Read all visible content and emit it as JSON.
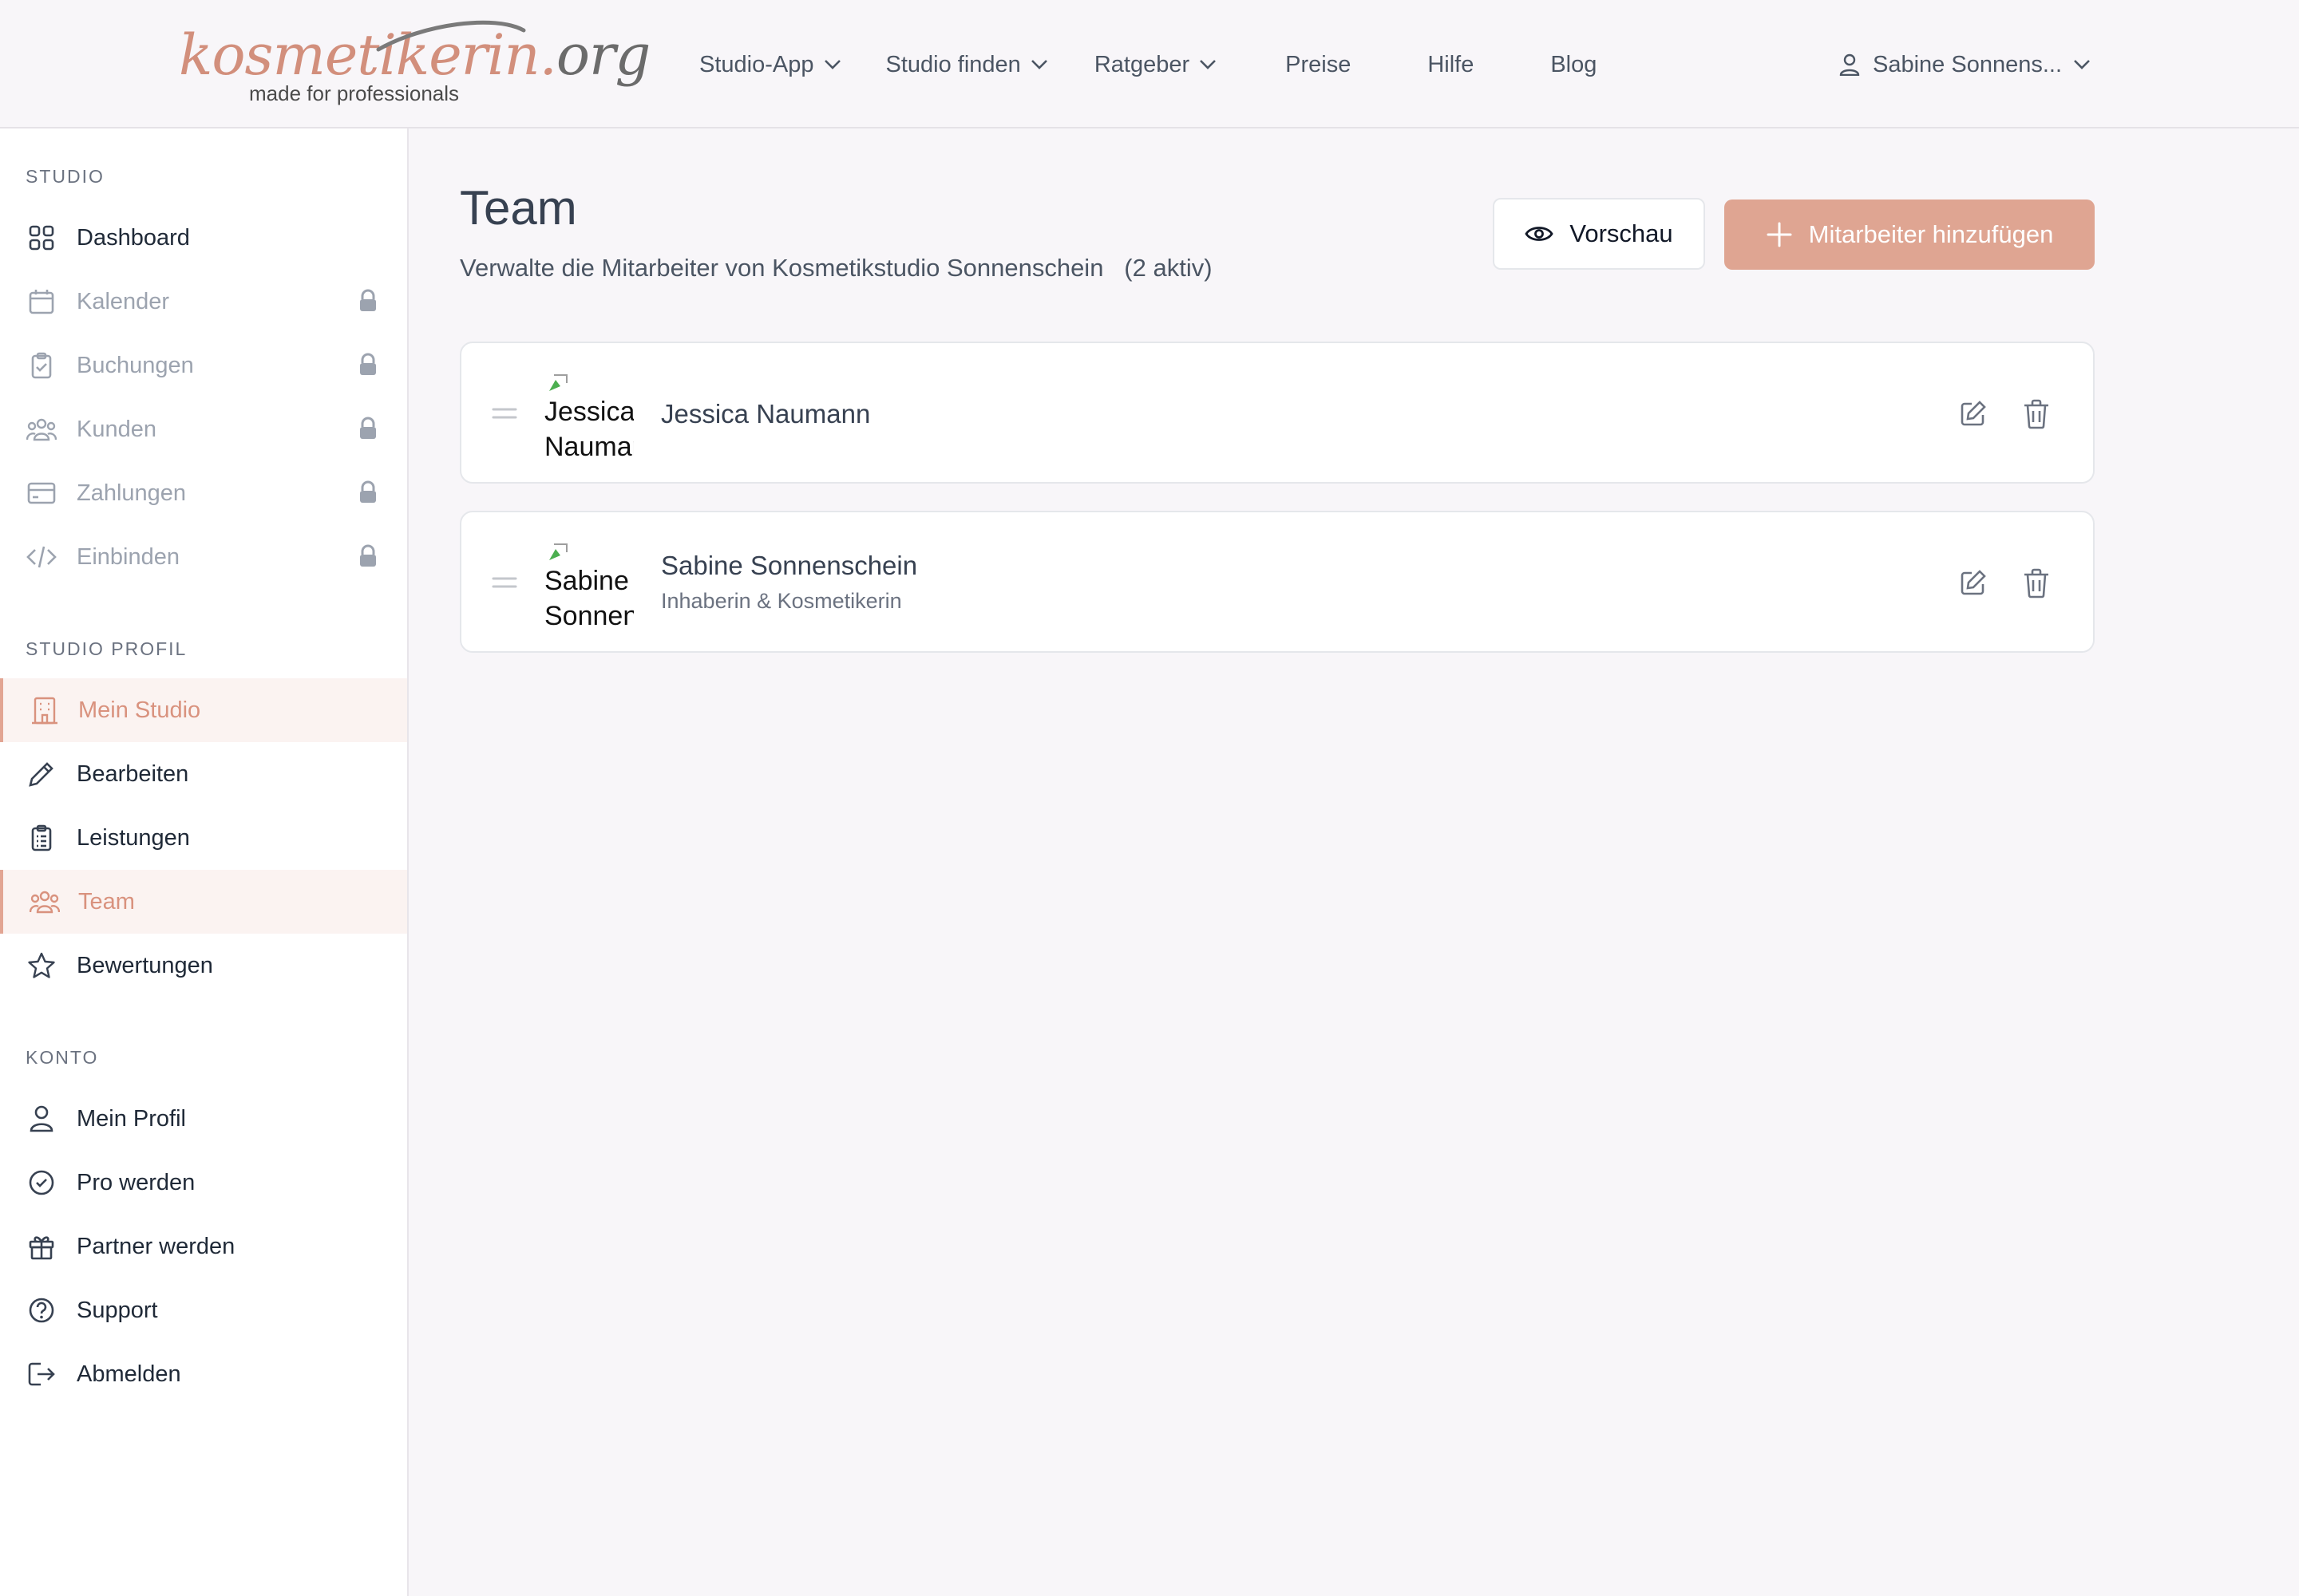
{
  "brand": {
    "name_main": "kosmetikerin.",
    "name_tld": "org",
    "tagline": "made for professionals",
    "accent_color": "#dfa592"
  },
  "topnav": {
    "items": [
      {
        "label": "Studio-App",
        "dropdown": true
      },
      {
        "label": "Studio finden",
        "dropdown": true
      },
      {
        "label": "Ratgeber",
        "dropdown": true
      },
      {
        "label": "Preise",
        "dropdown": false
      },
      {
        "label": "Hilfe",
        "dropdown": false
      },
      {
        "label": "Blog",
        "dropdown": false
      }
    ],
    "user_label": "Sabine Sonnens..."
  },
  "sidebar": {
    "sections": {
      "studio": "STUDIO",
      "studio_profil": "STUDIO PROFIL",
      "konto": "KONTO"
    },
    "studio_items": [
      {
        "label": "Dashboard",
        "icon": "grid-icon",
        "locked": false
      },
      {
        "label": "Kalender",
        "icon": "calendar-icon",
        "locked": true
      },
      {
        "label": "Buchungen",
        "icon": "clipboard-check-icon",
        "locked": true
      },
      {
        "label": "Kunden",
        "icon": "users-icon",
        "locked": true
      },
      {
        "label": "Zahlungen",
        "icon": "credit-card-icon",
        "locked": true
      },
      {
        "label": "Einbinden",
        "icon": "code-icon",
        "locked": true
      }
    ],
    "profil_items": [
      {
        "label": "Mein Studio",
        "icon": "building-icon",
        "active": true
      },
      {
        "label": "Bearbeiten",
        "icon": "pencil-icon",
        "active": false
      },
      {
        "label": "Leistungen",
        "icon": "clipboard-list-icon",
        "active": false
      },
      {
        "label": "Team",
        "icon": "users-icon",
        "active": true
      },
      {
        "label": "Bewertungen",
        "icon": "star-icon",
        "active": false
      }
    ],
    "konto_items": [
      {
        "label": "Mein Profil",
        "icon": "user-icon"
      },
      {
        "label": "Pro werden",
        "icon": "badge-check-icon"
      },
      {
        "label": "Partner werden",
        "icon": "gift-icon"
      },
      {
        "label": "Support",
        "icon": "question-circle-icon"
      },
      {
        "label": "Abmelden",
        "icon": "logout-icon"
      }
    ]
  },
  "main": {
    "title": "Team",
    "subtitle": "Verwalte die Mitarbeiter von Kosmetikstudio Sonnenschein",
    "active_count": "(2 aktiv)",
    "preview_label": "Vorschau",
    "add_label": "Mitarbeiter hinzufügen",
    "members": [
      {
        "name": "Jessica Naumann",
        "role": "",
        "avatar_alt": "Jessica Naumann"
      },
      {
        "name": "Sabine Sonnenschein",
        "role": "Inhaberin & Kosmetikerin",
        "avatar_alt": "Sabine Sonnenschein"
      }
    ]
  }
}
